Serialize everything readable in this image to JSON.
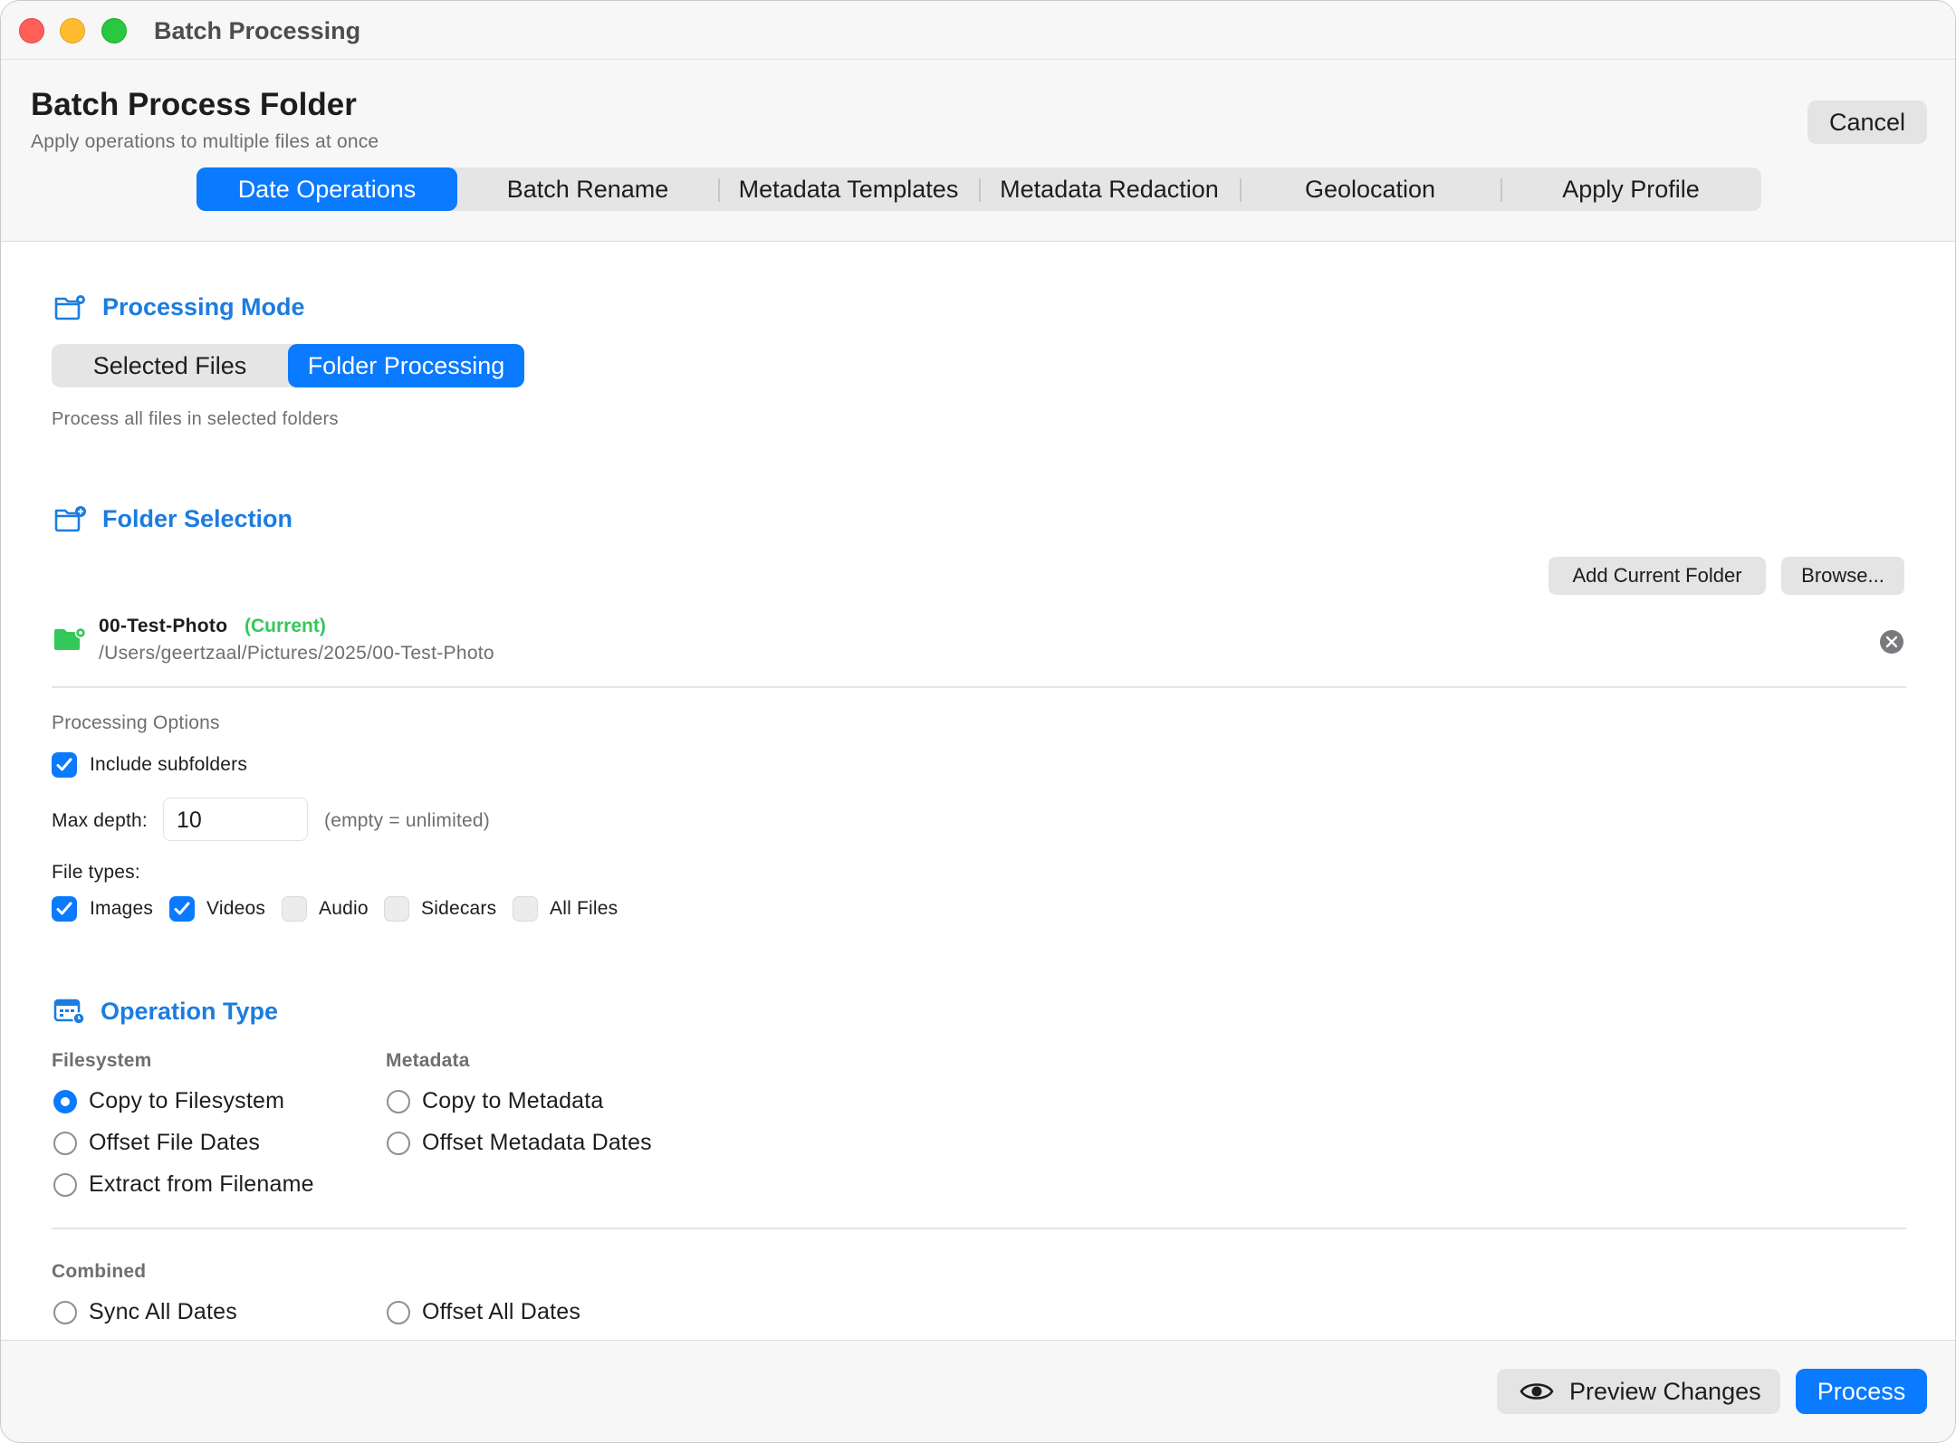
{
  "window": {
    "title": "Batch Processing"
  },
  "header": {
    "title": "Batch Process Folder",
    "subtitle": "Apply operations to multiple files at once",
    "cancel_label": "Cancel"
  },
  "tabs": [
    {
      "label": "Date Operations",
      "selected": true
    },
    {
      "label": "Batch Rename",
      "selected": false
    },
    {
      "label": "Metadata Templates",
      "selected": false
    },
    {
      "label": "Metadata Redaction",
      "selected": false
    },
    {
      "label": "Geolocation",
      "selected": false
    },
    {
      "label": "Apply Profile",
      "selected": false
    }
  ],
  "processing_mode": {
    "title": "Processing Mode",
    "icon": "folder-gear-icon",
    "options": [
      {
        "label": "Selected Files",
        "selected": false
      },
      {
        "label": "Folder Processing",
        "selected": true
      }
    ],
    "hint": "Process all files in selected folders"
  },
  "folder_selection": {
    "title": "Folder Selection",
    "icon": "folder-add-icon",
    "add_current_label": "Add Current Folder",
    "browse_label": "Browse...",
    "folders": [
      {
        "name": "00-Test-Photo",
        "tag": "(Current)",
        "path": "/Users/geertzaal/Pictures/2025/00-Test-Photo"
      }
    ],
    "options_label": "Processing Options",
    "include_subfolders": {
      "label": "Include subfolders",
      "checked": true
    },
    "max_depth": {
      "label": "Max depth:",
      "value": "10",
      "hint": "(empty = unlimited)"
    },
    "file_types_label": "File types:",
    "file_types": [
      {
        "label": "Images",
        "checked": true
      },
      {
        "label": "Videos",
        "checked": true
      },
      {
        "label": "Audio",
        "checked": false
      },
      {
        "label": "Sidecars",
        "checked": false
      },
      {
        "label": "All Files",
        "checked": false
      }
    ]
  },
  "operation_type": {
    "title": "Operation Type",
    "icon": "calendar-clock-icon",
    "filesystem_label": "Filesystem",
    "metadata_label": "Metadata",
    "filesystem_options": [
      {
        "label": "Copy to Filesystem",
        "selected": true
      },
      {
        "label": "Offset File Dates",
        "selected": false
      },
      {
        "label": "Extract from Filename",
        "selected": false
      }
    ],
    "metadata_options": [
      {
        "label": "Copy to Metadata",
        "selected": false
      },
      {
        "label": "Offset Metadata Dates",
        "selected": false
      }
    ],
    "combined_label": "Combined",
    "combined_options": [
      {
        "label": "Sync All Dates",
        "selected": false
      },
      {
        "label": "Offset All Dates",
        "selected": false
      }
    ]
  },
  "footer": {
    "preview_label": "Preview Changes",
    "process_label": "Process"
  },
  "colors": {
    "accent": "#0a7aff",
    "section_title": "#1c7ce0",
    "current_tag": "#34c759"
  }
}
